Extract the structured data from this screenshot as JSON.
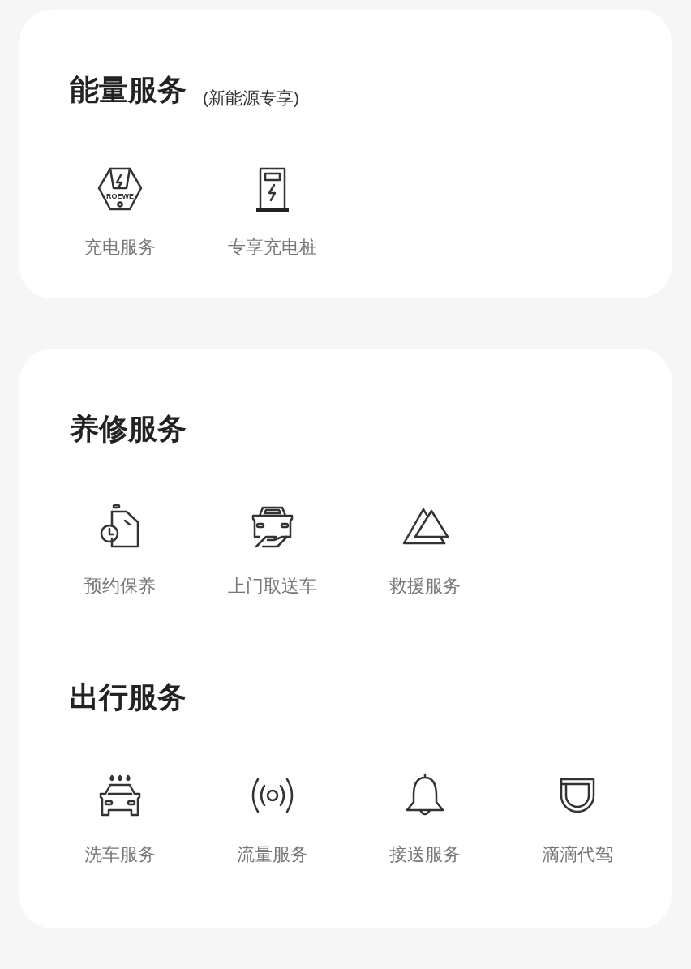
{
  "cards": [
    {
      "sections": [
        {
          "title": "能量服务",
          "note": "(新能源专享)",
          "items": [
            {
              "label": "充电服务",
              "kind": "charger",
              "logo_text": "ROEWE"
            },
            {
              "label": "专享充电桩",
              "kind": "pile"
            }
          ]
        }
      ]
    },
    {
      "sections": [
        {
          "title": "养修服务",
          "items": [
            {
              "label": "预约保养",
              "kind": "maintenance"
            },
            {
              "label": "上门取送车",
              "kind": "car-hand"
            },
            {
              "label": "救援服务",
              "kind": "triangles"
            }
          ]
        },
        {
          "title": "出行服务",
          "items": [
            {
              "label": "洗车服务",
              "kind": "car-wash"
            },
            {
              "label": "流量服务",
              "kind": "signal"
            },
            {
              "label": "接送服务",
              "kind": "bell"
            },
            {
              "label": "滴滴代驾",
              "kind": "d-logo"
            }
          ]
        }
      ]
    }
  ]
}
